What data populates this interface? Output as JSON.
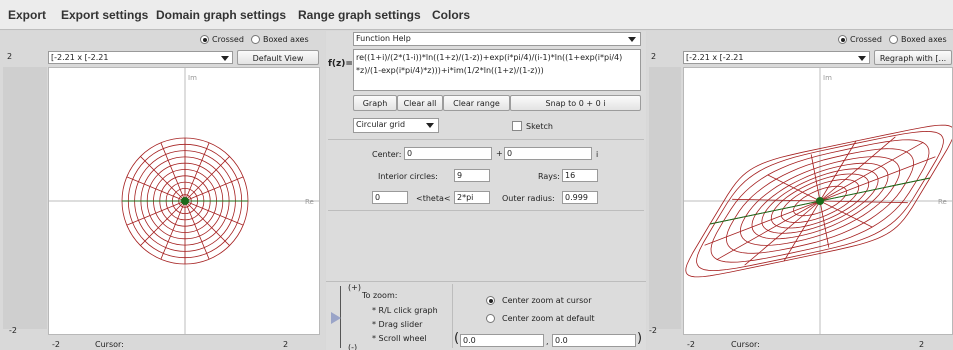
{
  "menu": {
    "items": [
      "Export",
      "Export settings",
      "Domain graph settings",
      "Range graph settings",
      "Colors"
    ]
  },
  "domain": {
    "axes_crossed": "Crossed",
    "axes_boxed": "Boxed axes",
    "range_select": "[-2.21 x [-2.21",
    "view_button": "Default View",
    "axis_top": "2",
    "axis_left_bottom": "-2",
    "bottom_left": "-2",
    "bottom_right": "2",
    "cursor_label": "Cursor:",
    "im_label": "Im",
    "re_label": "Re"
  },
  "center": {
    "help_select": "Function Help",
    "f_label": "f(z)=",
    "formula": [
      "re((1+i)/(2*(1-i))*ln((1+z)/(1-z))+exp(i*pi/4)/(i-1)*ln((1+exp(i*pi/4)",
      "*z)/(1-exp(i*pi/4)*z)))+i*im(1/2*ln((1+z)/(1-z)))"
    ],
    "buttons": {
      "graph": "Graph",
      "clear_all": "Clear all",
      "clear_range": "Clear range",
      "snap": "Snap to 0 + 0 i"
    },
    "grid_select": "Circular grid",
    "sketch_label": "Sketch",
    "center_label": "Center:",
    "center_re": "0",
    "plus": "+",
    "center_im": "0",
    "i_label": "i",
    "interior_label": "Interior circles:",
    "interior_value": "9",
    "rays_label": "Rays:",
    "rays_value": "16",
    "theta_min": "0",
    "theta_label": "<theta<",
    "theta_max": "2*pi",
    "outer_label": "Outer radius:",
    "outer_value": "0.999",
    "zoom": {
      "plus": "(+)",
      "minus": "(-)",
      "title": "To zoom:",
      "hint1": "* R/L click graph",
      "hint2": "* Drag slider",
      "hint3": "* Scroll wheel",
      "opt_cursor": "Center zoom at cursor",
      "opt_default": "Center zoom at default",
      "coord_re": "0.0",
      "coord_im": "0.0",
      "paren_open": "(",
      "comma": ",",
      "paren_close": ")"
    }
  },
  "range": {
    "axes_crossed": "Crossed",
    "axes_boxed": "Boxed axes",
    "range_select": "[-2.21 x [-2.21",
    "view_button": "Regraph with [...",
    "axis_top": "2",
    "axis_left_bottom": "-2",
    "bottom_left": "-2",
    "bottom_right": "2",
    "cursor_label": "Cursor:",
    "im_label": "Im",
    "re_label": "Re"
  },
  "colors": {
    "grid": "#a52020",
    "accent": "#1a6b1a",
    "axis": "#bcbcbc"
  }
}
